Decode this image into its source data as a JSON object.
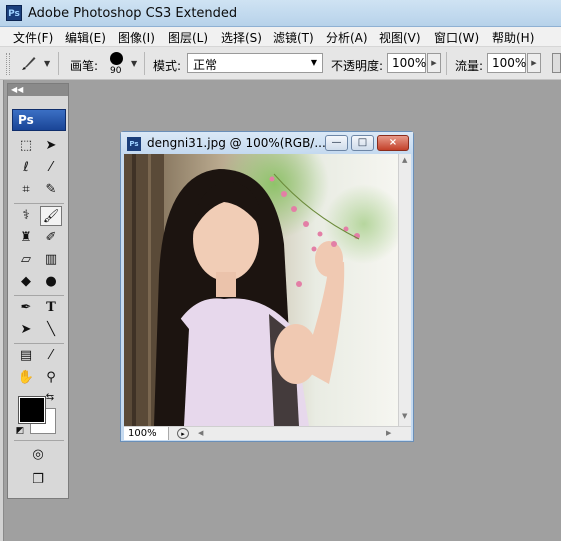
{
  "window": {
    "title": "Adobe Photoshop CS3 Extended",
    "app_icon": "Ps"
  },
  "menu": [
    "文件(F)",
    "编辑(E)",
    "图像(I)",
    "图层(L)",
    "选择(S)",
    "滤镜(T)",
    "分析(A)",
    "视图(V)",
    "窗口(W)",
    "帮助(H)"
  ],
  "options": {
    "brush_label": "画笔:",
    "brush_size": "90",
    "mode_label": "模式:",
    "mode_value": "正常",
    "opacity_label": "不透明度:",
    "opacity_value": "100%",
    "flow_label": "流量:",
    "flow_value": "100%"
  },
  "toolbox": {
    "logo": "Ps",
    "foreground_color": "#000000",
    "background_color": "#ffffff"
  },
  "document": {
    "icon": "Ps",
    "title": "dengni31.jpg @ 100%(RGB/...",
    "zoom": "100%",
    "controls": {
      "minimize": "—",
      "maximize": "□",
      "close": "×"
    }
  }
}
